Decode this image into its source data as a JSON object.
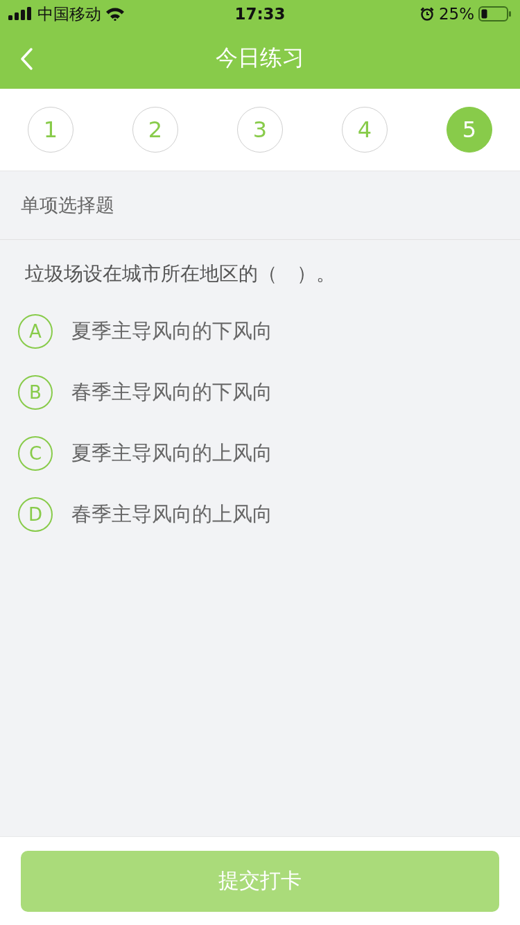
{
  "status_bar": {
    "carrier": "中国移动",
    "time": "17:33",
    "battery": "25%"
  },
  "nav": {
    "title": "今日练习"
  },
  "question_tabs": [
    {
      "label": "1",
      "selected": false
    },
    {
      "label": "2",
      "selected": false
    },
    {
      "label": "3",
      "selected": false
    },
    {
      "label": "4",
      "selected": false
    },
    {
      "label": "5",
      "selected": true
    }
  ],
  "section_title": "单项选择题",
  "question": "垃圾场设在城市所在地区的（　）。",
  "options": [
    {
      "letter": "A",
      "text": "夏季主导风向的下风向",
      "selected": false
    },
    {
      "letter": "B",
      "text": "春季主导风向的下风向",
      "selected": false
    },
    {
      "letter": "C",
      "text": "夏季主导风向的上风向",
      "selected": false
    },
    {
      "letter": "D",
      "text": "春季主导风向的上风向",
      "selected": false
    }
  ],
  "submit": {
    "label": "提交打卡",
    "disabled": true
  }
}
